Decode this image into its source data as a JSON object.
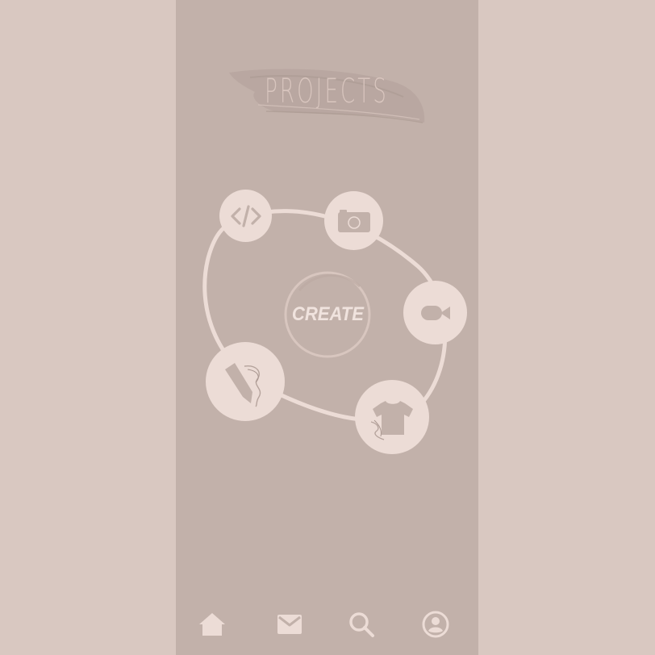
{
  "header": {
    "title": "PROJECTS"
  },
  "center_button": {
    "label": "CREATE"
  },
  "project_types": [
    {
      "name": "code",
      "icon": "code-icon"
    },
    {
      "name": "photo",
      "icon": "camera-icon"
    },
    {
      "name": "video",
      "icon": "video-camera-icon"
    },
    {
      "name": "apparel",
      "icon": "tshirt-icon"
    },
    {
      "name": "drawing",
      "icon": "pencil-icon"
    }
  ],
  "bottom_nav": [
    {
      "name": "home",
      "icon": "home-icon"
    },
    {
      "name": "messages",
      "icon": "mail-icon"
    },
    {
      "name": "search",
      "icon": "search-icon"
    },
    {
      "name": "profile",
      "icon": "user-icon"
    }
  ],
  "colors": {
    "outer_background": "#d9c8c1",
    "phone_background": "#c2b1aa",
    "accent_light": "#ecdcd6",
    "icon_dark": "#c2b1aa"
  }
}
